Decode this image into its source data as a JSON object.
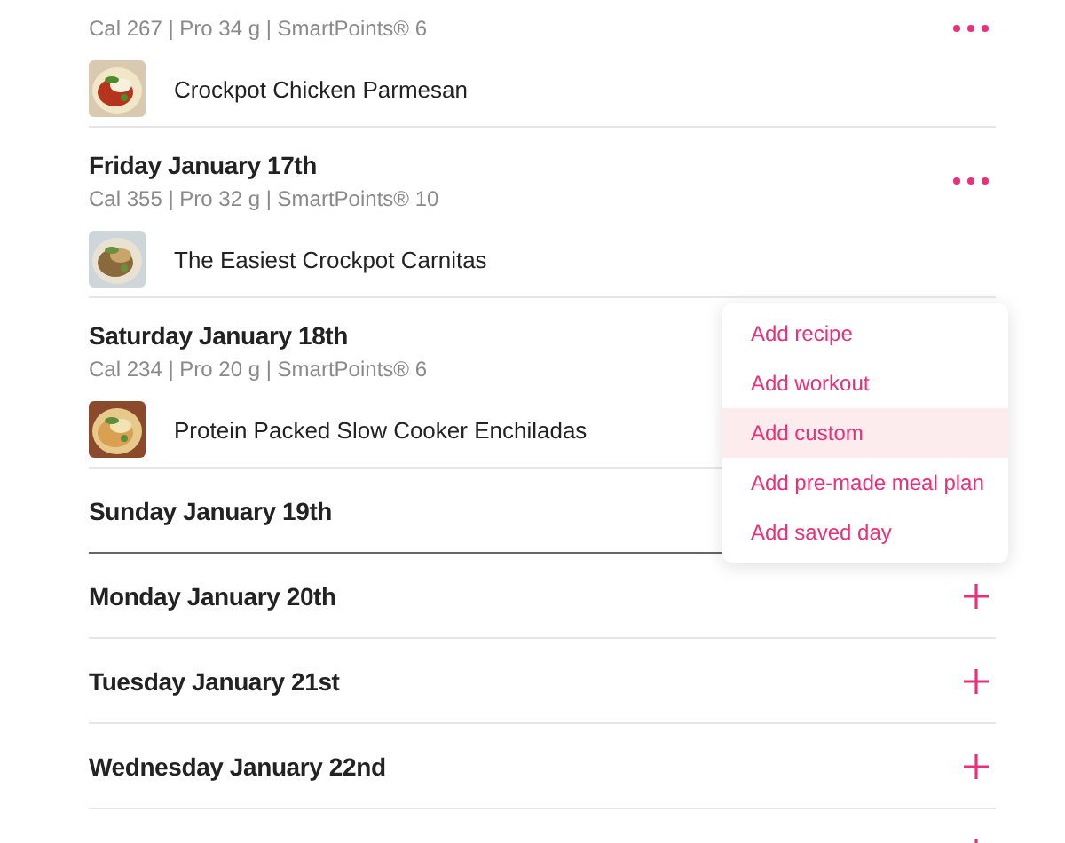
{
  "days": [
    {
      "kind": "meal",
      "stats": "Cal 267 | Pro 34 g | SmartPoints® 6",
      "recipe": {
        "name": "Crockpot Chicken Parmesan"
      },
      "highlighted": false
    },
    {
      "kind": "meal",
      "title": "Friday January 17th",
      "stats": "Cal 355 | Pro 32 g | SmartPoints® 10",
      "recipe": {
        "name": "The Easiest Crockpot Carnitas"
      },
      "highlighted": false
    },
    {
      "kind": "meal",
      "title": "Saturday January 18th",
      "stats": "Cal 234 | Pro 20 g | SmartPoints® 6",
      "recipe": {
        "name": "Protein Packed Slow Cooker Enchiladas"
      },
      "highlighted": false
    },
    {
      "kind": "empty",
      "title": "Sunday January 19th",
      "highlighted": true
    },
    {
      "kind": "empty",
      "title": "Monday January 20th",
      "highlighted": false,
      "add_button": true
    },
    {
      "kind": "empty",
      "title": "Tuesday January 21st",
      "highlighted": false,
      "add_button": true
    },
    {
      "kind": "empty",
      "title": "Wednesday January 22nd",
      "highlighted": false,
      "add_button": true
    },
    {
      "kind": "empty",
      "add_button": true
    }
  ],
  "add_menu": {
    "items": [
      {
        "label": "Add recipe",
        "selected": false
      },
      {
        "label": "Add workout",
        "selected": false
      },
      {
        "label": "Add custom",
        "selected": true
      },
      {
        "label": "Add pre-made meal plan",
        "selected": false
      },
      {
        "label": "Add saved day",
        "selected": false
      }
    ]
  }
}
